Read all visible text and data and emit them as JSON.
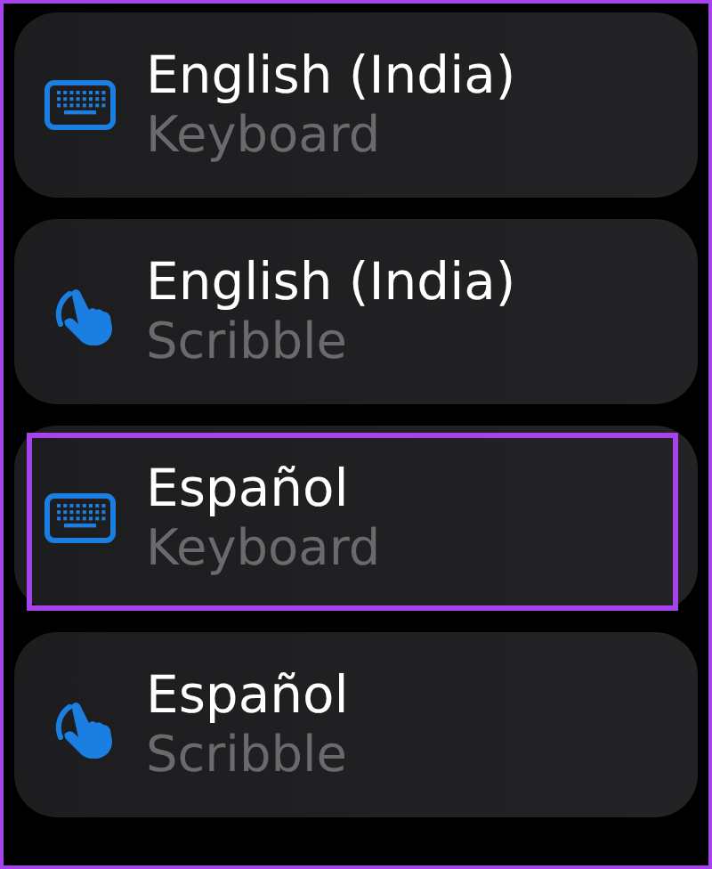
{
  "items": [
    {
      "kind": "keyboard",
      "title": "English (India)",
      "subtitle": "Keyboard",
      "highlighted": false
    },
    {
      "kind": "scribble",
      "title": "English (India)",
      "subtitle": "Scribble",
      "highlighted": false
    },
    {
      "kind": "keyboard",
      "title": "Español",
      "subtitle": "Keyboard",
      "highlighted": true
    },
    {
      "kind": "scribble",
      "title": "Español",
      "subtitle": "Scribble",
      "highlighted": false
    }
  ]
}
